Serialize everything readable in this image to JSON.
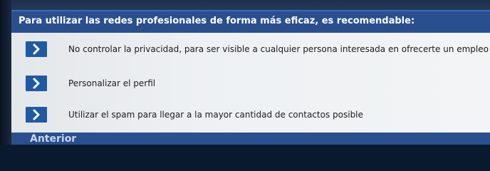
{
  "question": "Para utilizar las redes profesionales de forma más eficaz, es recomendable:",
  "options": [
    {
      "text": "No controlar la privacidad, para ser visible a cualquier persona interesada en ofrecerte un empleo"
    },
    {
      "text": "Personalizar el perfil"
    },
    {
      "text": "Utilizar el spam para llegar a la mayor cantidad de contactos posible"
    }
  ],
  "navigation": {
    "previous_label": "Anterior"
  },
  "colors": {
    "bar": "#2a4f8f",
    "chevron": "#1f5aa5",
    "content_bg": "#eef1f3"
  }
}
